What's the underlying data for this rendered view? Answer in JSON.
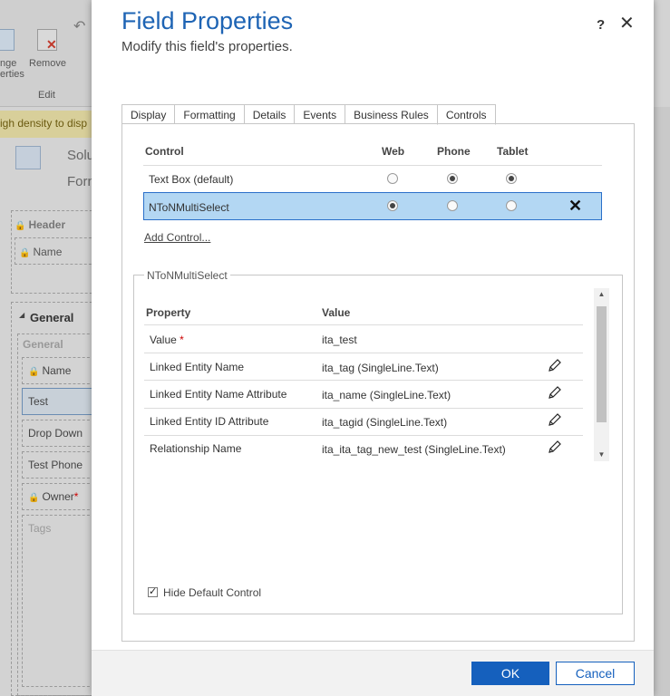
{
  "background": {
    "ribbon": {
      "change_properties_label_1": "nge",
      "change_properties_label_2": "erties",
      "remove_label": "Remove",
      "group_label": "Edit"
    },
    "banner_text": "igh density to disp",
    "solution_text": "Solu",
    "form_text": "Forn",
    "header_label": "Header",
    "header_name_label": "Name",
    "general_title": "General",
    "general_label": "General",
    "fields": [
      "Name",
      "Test",
      "Drop Down",
      "Test Phone",
      "Owner"
    ],
    "owner_required_mark": "*",
    "tags_label": "Tags"
  },
  "dialog": {
    "title": "Field Properties",
    "subtitle": "Modify this field's properties.",
    "help_label": "?",
    "close_label": "✕",
    "tabs": [
      {
        "label": "Display",
        "active": false
      },
      {
        "label": "Formatting",
        "active": false
      },
      {
        "label": "Details",
        "active": false
      },
      {
        "label": "Events",
        "active": false
      },
      {
        "label": "Business Rules",
        "active": false
      },
      {
        "label": "Controls",
        "active": true
      }
    ],
    "controls_table": {
      "headers": {
        "control": "Control",
        "web": "Web",
        "phone": "Phone",
        "tablet": "Tablet"
      },
      "rows": [
        {
          "name": "Text Box (default)",
          "web": false,
          "phone": true,
          "tablet": true,
          "selected": false
        },
        {
          "name": "NToNMultiSelect",
          "web": true,
          "phone": false,
          "tablet": false,
          "selected": true
        }
      ],
      "delete_label": "✕",
      "add_control_label": "Add Control..."
    },
    "properties": {
      "legend": "NToNMultiSelect",
      "headers": {
        "property": "Property",
        "value": "Value"
      },
      "rows": [
        {
          "property": "Value",
          "required_mark": "*",
          "value": "ita_test",
          "editable": false
        },
        {
          "property": "Linked Entity Name",
          "value": "ita_tag (SingleLine.Text)",
          "editable": true
        },
        {
          "property": "Linked Entity Name Attribute",
          "value": "ita_name (SingleLine.Text)",
          "editable": true
        },
        {
          "property": "Linked Entity ID Attribute",
          "value": "ita_tagid (SingleLine.Text)",
          "editable": true
        },
        {
          "property": "Relationship Name",
          "value": "ita_ita_tag_new_test (SingleLine.Text)",
          "editable": true
        }
      ]
    },
    "hide_default_control": {
      "label": "Hide Default Control",
      "checked": true
    },
    "buttons": {
      "ok": "OK",
      "cancel": "Cancel"
    },
    "colors": {
      "title": "#1e64b4",
      "selection": "#b3d7f3",
      "primary_button": "#1560bd"
    }
  }
}
